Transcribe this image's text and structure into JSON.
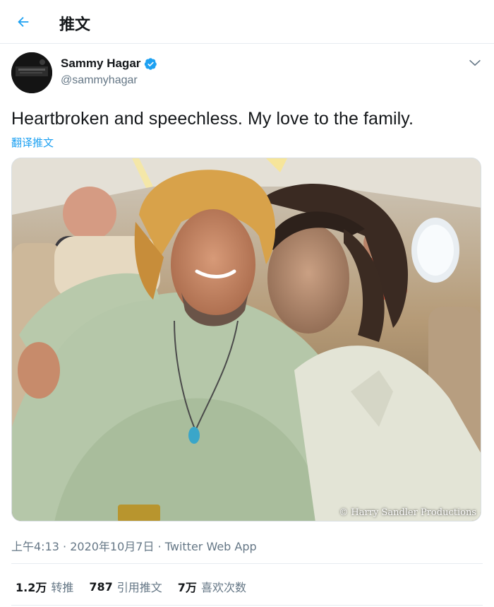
{
  "header": {
    "back_icon": "arrow-left-icon",
    "title": "推文"
  },
  "author": {
    "display_name": "Sammy Hagar",
    "handle": "@sammyhagar",
    "verified": true,
    "verified_icon": "verified-badge-icon",
    "more_icon": "chevron-down-icon"
  },
  "tweet": {
    "text": "Heartbroken and speechless. My love to the family.",
    "translate_label": "翻译推文",
    "media_watermark": "© Harry Sandler Productions"
  },
  "meta": {
    "time": "上午4:13",
    "separator": " · ",
    "date": "2020年10月7日",
    "source": "Twitter Web App"
  },
  "stats": [
    {
      "count": "1.2万",
      "label": "转推"
    },
    {
      "count": "787",
      "label": "引用推文"
    },
    {
      "count": "7万",
      "label": "喜欢次数"
    }
  ],
  "colors": {
    "accent": "#1da1f2",
    "text_primary": "#14171a",
    "text_secondary": "#657786",
    "divider": "#e6ecf0"
  }
}
